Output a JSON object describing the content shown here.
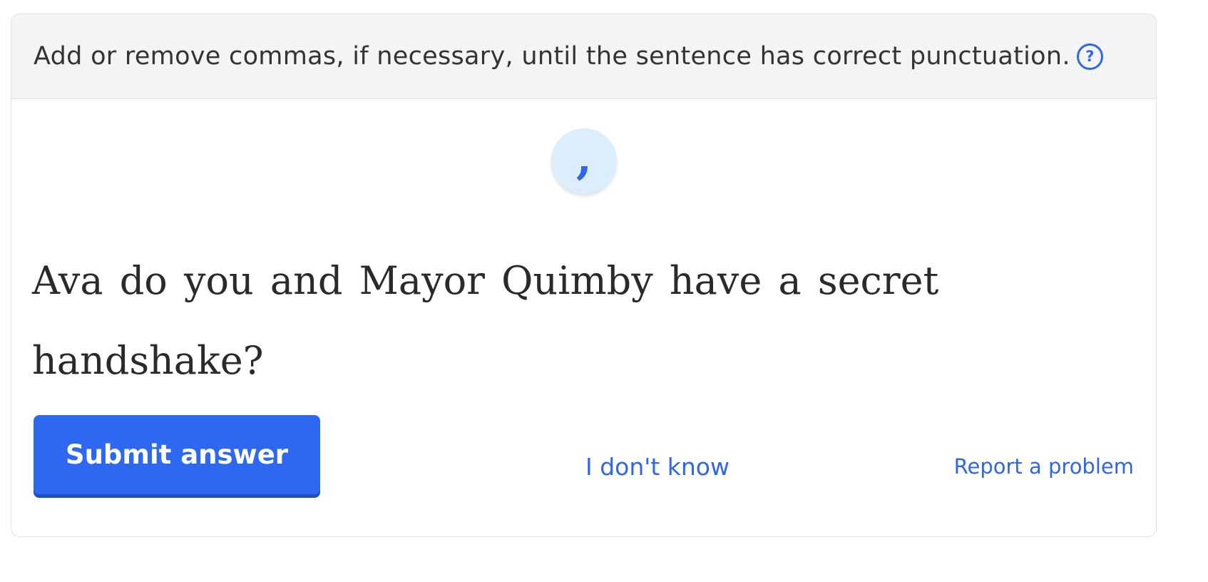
{
  "instruction": {
    "text": "Add or remove commas, if necessary, until the sentence has correct punctuation.",
    "help_icon": "question-mark-circle-icon",
    "help_glyph": "?"
  },
  "punctuation_tile": {
    "glyph": ",",
    "icon": "comma-icon"
  },
  "sentence": {
    "words": [
      "Ava",
      "do",
      "you",
      "and",
      "Mayor",
      "Quimby",
      "have",
      "a",
      "secret",
      "handshake?"
    ]
  },
  "actions": {
    "submit_label": "Submit answer",
    "dont_know_label": "I don't know",
    "report_label": "Report a problem"
  },
  "colors": {
    "accent": "#2f67e8",
    "button": "#2e67f0",
    "header_bg": "#f4f4f4",
    "tile_bg": "#dceefc",
    "text": "#2a2a2a"
  }
}
